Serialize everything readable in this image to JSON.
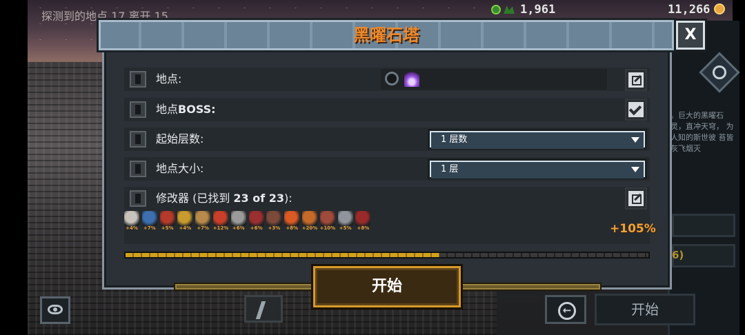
{
  "hud": {
    "top_left_text": "探测到的地点 17 离开 15",
    "plant_count": "1,961",
    "gold_count": "11,266"
  },
  "side_panel": {
    "description": "。巨大的黑曜石 灵，直冲天穹， 为人知的斯世彼 苔皆灰飞烟灭",
    "partial_count": "6)",
    "start_label": "开始"
  },
  "dialog": {
    "title": "黑曜石塔",
    "close_label": "X",
    "rows": {
      "location_label": "地点:",
      "boss_label_prefix": "地点",
      "boss_label_bold": "BOSS:",
      "start_floor_label": "起始层数:",
      "start_floor_value": "1 层数",
      "size_label": "地点大小:",
      "size_value": "1 层",
      "modifiers_prefix": "修改器 (已找到 ",
      "modifiers_count": "23 of 23",
      "modifiers_suffix": "):"
    },
    "modifiers": [
      {
        "icon": "skull-icon",
        "pct": "+4%",
        "color": "#c9c3bc"
      },
      {
        "icon": "shield-icon",
        "pct": "+7%",
        "color": "#3d6fb0"
      },
      {
        "icon": "demon-icon",
        "pct": "+5%",
        "color": "#b53a2a"
      },
      {
        "icon": "bird-icon",
        "pct": "+4%",
        "color": "#c99a2e"
      },
      {
        "icon": "scroll-icon",
        "pct": "+7%",
        "color": "#b7894a"
      },
      {
        "icon": "seal-icon",
        "pct": "+12%",
        "color": "#c8402a"
      },
      {
        "icon": "stone-icon",
        "pct": "+6%",
        "color": "#9a9a9a"
      },
      {
        "icon": "horn-icon",
        "pct": "+6%",
        "color": "#9b2f2f"
      },
      {
        "icon": "claw-icon",
        "pct": "+3%",
        "color": "#7d4a3a"
      },
      {
        "icon": "fire-icon",
        "pct": "+8%",
        "color": "#d95a22"
      },
      {
        "icon": "crown-icon",
        "pct": "+20%",
        "color": "#c66a2a"
      },
      {
        "icon": "beast-icon",
        "pct": "+10%",
        "color": "#a04a3a"
      },
      {
        "icon": "rock-icon",
        "pct": "+5%",
        "color": "#8f959a"
      },
      {
        "icon": "spider-icon",
        "pct": "+8%",
        "color": "#9a2a2a"
      }
    ],
    "modifier_total": "+105%",
    "progress_fraction": 0.6,
    "start_label": "开始"
  }
}
